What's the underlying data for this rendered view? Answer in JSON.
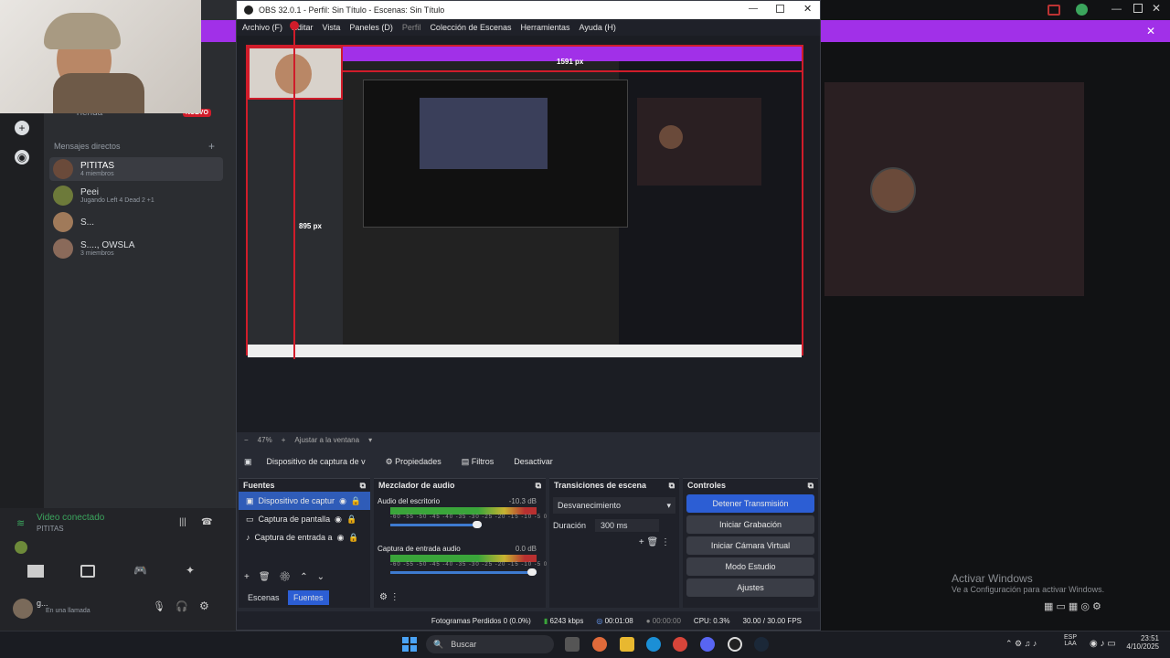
{
  "obs": {
    "title": "OBS 32.0.1 - Perfil: Sin Título - Escenas: Sin Título",
    "menu": [
      "Archivo (F)",
      "Editar",
      "Vista",
      "Paneles (D)",
      "Perfil",
      "Colección de Escenas",
      "Herramientas",
      "Ayuda (H)"
    ],
    "preview": {
      "width_label": "1591 px",
      "height_label": "895 px"
    },
    "zoom": {
      "value": "47%",
      "fit": "Ajustar a la ventana"
    },
    "source_toolbar": {
      "device": "Dispositivo de captura de v",
      "properties": "Propiedades",
      "filters": "Filtros",
      "deactivate": "Desactivar"
    },
    "docks": {
      "sources": {
        "title": "Fuentes",
        "items": [
          {
            "label": "Dispositivo de captur",
            "selected": true
          },
          {
            "label": "Captura de pantalla",
            "selected": false
          },
          {
            "label": "Captura de entrada a",
            "selected": false
          }
        ]
      },
      "mixer": {
        "title": "Mezclador de audio",
        "channels": [
          {
            "label": "Audio del escritorio",
            "level": "-10.3 dB"
          },
          {
            "label": "Captura de entrada audio",
            "level": "0.0 dB"
          }
        ],
        "scale": "-60 -55 -50 -45 -40 -35 -30 -25 -20 -15 -10 -5 0"
      },
      "transitions": {
        "title": "Transiciones de escena",
        "selected": "Desvanecimiento",
        "duration_label": "Duración",
        "duration": "300 ms"
      },
      "controls": {
        "title": "Controles",
        "buttons": [
          "Detener Transmisión",
          "Iniciar Grabación",
          "Iniciar Cámara Virtual",
          "Modo Estudio",
          "Ajustes"
        ]
      },
      "tabs": [
        "Escenas",
        "Fuentes"
      ]
    },
    "status": {
      "dropped": "Fotogramas Perdidos 0 (0.0%)",
      "bitrate": "6243 kbps",
      "stream_time": "00:01:08",
      "rec_time": "00:00:00",
      "cpu": "CPU: 0.3%",
      "fps": "30.00 / 30.00 FPS"
    }
  },
  "discord": {
    "section_label": "Mensajes directos",
    "truncated_label": "Tienda",
    "new_badge": "NUEVO",
    "dms": [
      {
        "name": "PITITAS",
        "sub": "4 miembros"
      },
      {
        "name": "Peei",
        "sub": "Jugando Left 4 Dead 2 +1"
      },
      {
        "name": "S...",
        "sub": ""
      },
      {
        "name": "S...., OWSLA",
        "sub": "3 miembros"
      }
    ],
    "voice": {
      "status": "Video conectado",
      "channel": "PITITAS"
    },
    "user": {
      "name": "g...",
      "status": "En una llamada"
    }
  },
  "windows": {
    "activate_title": "Activar Windows",
    "activate_sub": "Ve a Configuración para activar Windows.",
    "search_placeholder": "Buscar",
    "tray": {
      "lang": "ESP",
      "region": "LAA",
      "time": "23:51",
      "date": "4/10/2025"
    }
  },
  "colors": {
    "obs_bg": "#272a33",
    "accent_blue": "#2c5ed4",
    "discord_purple": "#a130e8",
    "selection_red": "#d01c2a"
  }
}
